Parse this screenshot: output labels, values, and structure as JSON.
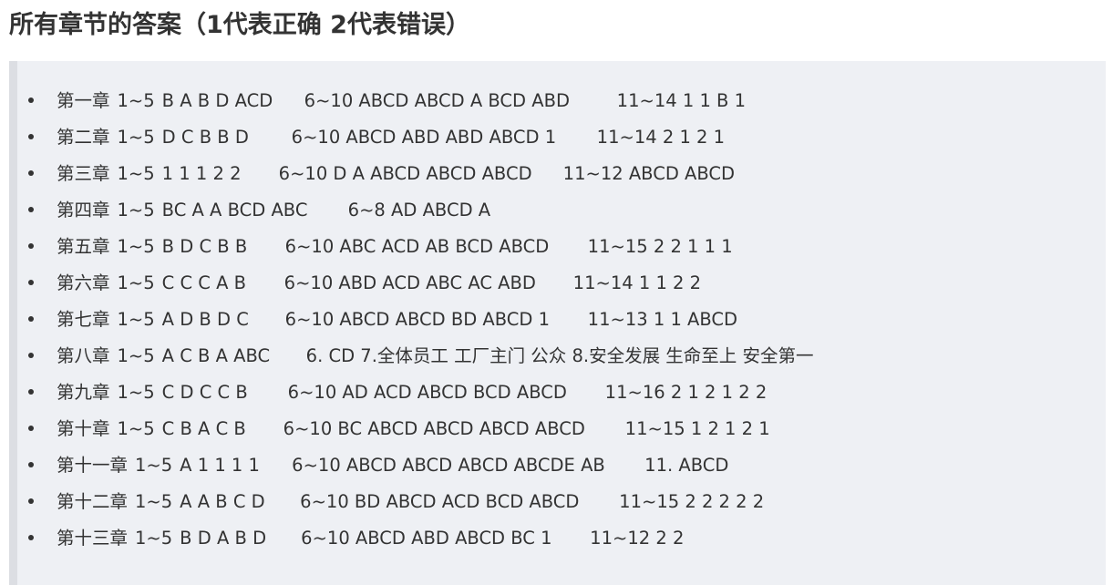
{
  "title": "所有章节的答案（1代表正确 2代表错误）",
  "chapters": [
    {
      "chapter": "第一章",
      "range": "1~5",
      "answers": "B A B D ACD",
      "rest": "6~10  ABCD ABCD  A  BCD  ABD",
      "tail": "11~14  1 1 B 1"
    },
    {
      "chapter": "第二章",
      "range": "1~5",
      "answers": "D C B B D",
      "rest": "6~10  ABCD ABD ABD ABCD 1",
      "tail": "11~14  2 1 2 1"
    },
    {
      "chapter": "第三章",
      "range": "1~5",
      "answers": "1 1 1 2 2",
      "rest": "6~10  D A ABCD ABCD ABCD",
      "tail": "11~12  ABCD ABCD"
    },
    {
      "chapter": "第四章",
      "range": "1~5",
      "answers": "BC A A BCD ABC",
      "rest": "6~8  AD ABCD A",
      "tail": ""
    },
    {
      "chapter": "第五章",
      "range": "1~5",
      "answers": "B D C B B",
      "rest": "6~10  ABC ACD AB BCD ABCD",
      "tail": "11~15  2 2 1 1 1"
    },
    {
      "chapter": "第六章",
      "range": "1~5",
      "answers": "C C C A B",
      "rest": "6~10  ABD ACD ABC AC ABD",
      "tail": "11~14  1 1 2 2"
    },
    {
      "chapter": "第七章",
      "range": "1~5",
      "answers": "A D B D C",
      "rest": "6~10  ABCD ABCD BD ABCD 1",
      "tail": "11~13  1 1 ABCD"
    },
    {
      "chapter": "第八章",
      "range": "1~5",
      "answers": "A C B A ABC",
      "rest": "6. CD  7.全体员工 工厂主门 公众  8.安全发展 生命至上 安全第一",
      "tail": ""
    },
    {
      "chapter": "第九章",
      "range": "1~5",
      "answers": "C D C C B",
      "rest": "6~10  AD ACD ABCD BCD ABCD",
      "tail": "11~16  2 1 2 1 2 2"
    },
    {
      "chapter": "第十章",
      "range": "1~5",
      "answers": "C B A C B",
      "rest": "6~10  BC ABCD ABCD ABCD ABCD",
      "tail": "11~15  1 2 1 2 1"
    },
    {
      "chapter": "第十一章",
      "range": "1~5",
      "answers": "A 1 1 1 1",
      "rest": "6~10  ABCD ABCD ABCD ABCDE AB",
      "tail": "11. ABCD"
    },
    {
      "chapter": "第十二章",
      "range": "1~5",
      "answers": "A A B C D",
      "rest": "6~10  BD ABCD ACD BCD ABCD",
      "tail": "11~15  2 2 2 2 2"
    },
    {
      "chapter": "第十三章",
      "range": "1~5",
      "answers": "B D A B D",
      "rest": "6~10  ABCD ABD ABCD BC 1",
      "tail": "11~12  2 2"
    }
  ]
}
